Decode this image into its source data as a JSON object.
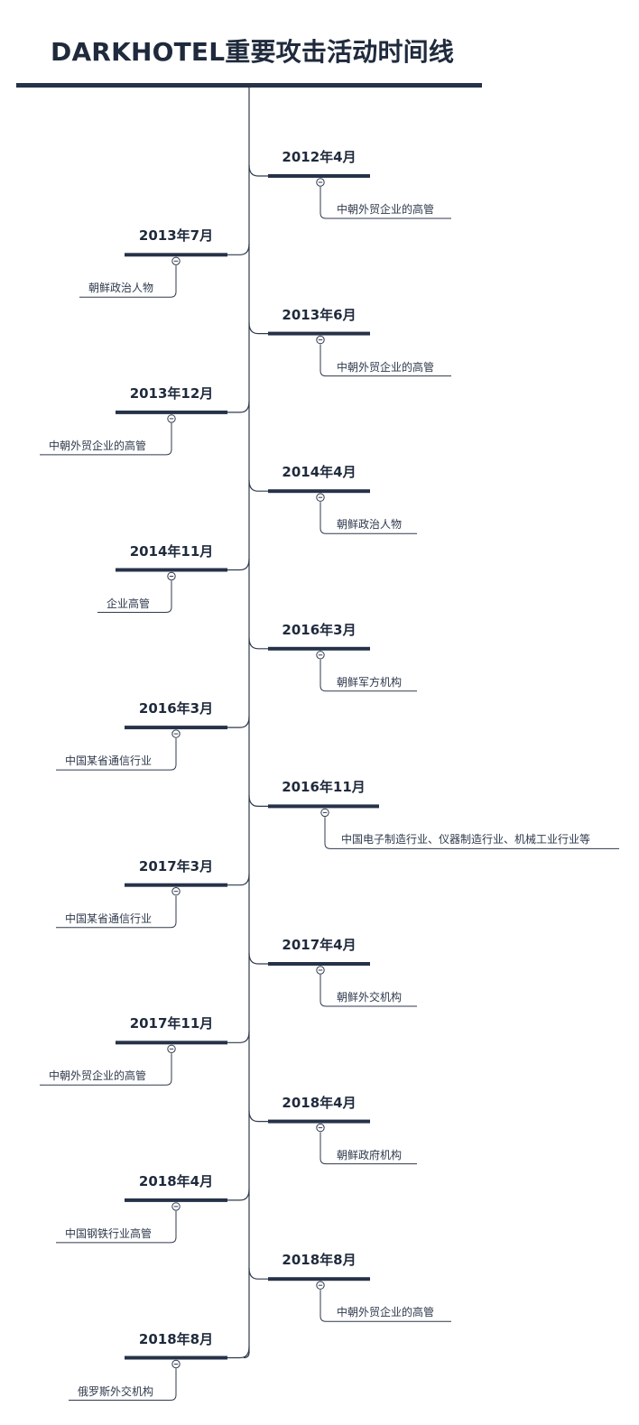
{
  "title": "DARKHOTEL重要攻击活动时间线",
  "colors": {
    "primary": "#263248",
    "line": "#2f3a4c",
    "text": "#1f2a3c"
  },
  "events": [
    {
      "date": "2012年4月",
      "target": "中朝外贸企业的高管"
    },
    {
      "date": "2013年7月",
      "target": "朝鲜政治人物"
    },
    {
      "date": "2013年6月",
      "target": "中朝外贸企业的高管"
    },
    {
      "date": "2013年12月",
      "target": "中朝外贸企业的高管"
    },
    {
      "date": "2014年4月",
      "target": "朝鲜政治人物"
    },
    {
      "date": "2014年11月",
      "target": "企业高管"
    },
    {
      "date": "2016年3月",
      "target": "朝鲜军方机构"
    },
    {
      "date": "2016年3月",
      "target": "中国某省通信行业"
    },
    {
      "date": "2016年11月",
      "target": "中国电子制造行业、仪器制造行业、机械工业行业等"
    },
    {
      "date": "2017年3月",
      "target": "中国某省通信行业"
    },
    {
      "date": "2017年4月",
      "target": "朝鲜外交机构"
    },
    {
      "date": "2017年11月",
      "target": "中朝外贸企业的高管"
    },
    {
      "date": "2018年4月",
      "target": "朝鲜政府机构"
    },
    {
      "date": "2018年4月",
      "target": "中国钢铁行业高管"
    },
    {
      "date": "2018年8月",
      "target": "中朝外贸企业的高管"
    },
    {
      "date": "2018年8月",
      "target": "俄罗斯外交机构"
    }
  ]
}
